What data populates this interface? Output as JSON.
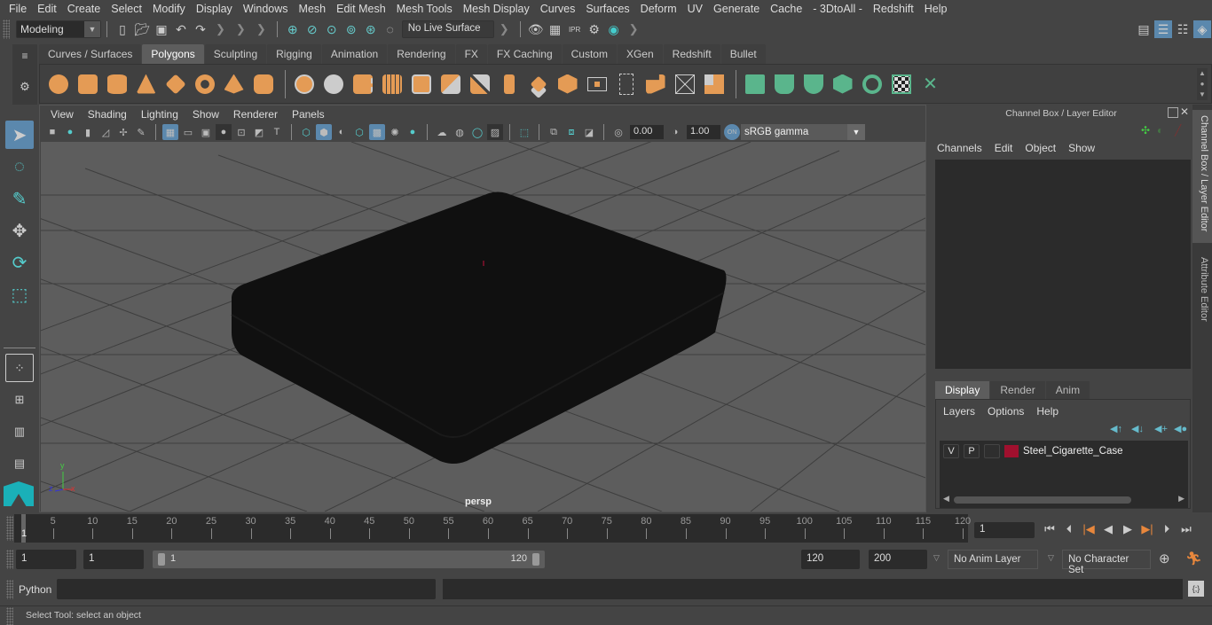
{
  "menubar": [
    "File",
    "Edit",
    "Create",
    "Select",
    "Modify",
    "Display",
    "Windows",
    "Mesh",
    "Edit Mesh",
    "Mesh Tools",
    "Mesh Display",
    "Curves",
    "Surfaces",
    "Deform",
    "UV",
    "Generate",
    "Cache",
    "- 3DtoAll -",
    "Redshift",
    "Help"
  ],
  "statusline": {
    "mode": "Modeling",
    "live_surface": "No Live Surface"
  },
  "shelf": {
    "tabs": [
      "Curves / Surfaces",
      "Polygons",
      "Sculpting",
      "Rigging",
      "Animation",
      "Rendering",
      "FX",
      "FX Caching",
      "Custom",
      "XGen",
      "Redshift",
      "Bullet"
    ],
    "active_tab": "Polygons",
    "orange_icons": [
      "poly-sphere-icon",
      "poly-cube-icon",
      "poly-cylinder-icon",
      "poly-cone-icon",
      "poly-plane-icon",
      "poly-torus-icon",
      "poly-pyramid-icon",
      "poly-pipe-icon",
      "combine-icon",
      "separate-icon",
      "mirror-icon",
      "smooth-icon",
      "boolean-icon",
      "extrude-icon",
      "bridge-icon",
      "multi-cut-icon",
      "bevel-icon",
      "merge-icon",
      "fill-hole-icon",
      "center-pivot-icon",
      "target-weld-icon",
      "poke-icon",
      "wedge-icon"
    ],
    "green_icons": [
      "planar-uv-icon",
      "cylindrical-uv-icon",
      "spherical-uv-icon",
      "automatic-uv-icon",
      "unfold-uv-icon",
      "uv-editor-icon",
      "layout-uv-icon"
    ]
  },
  "viewport": {
    "menu": [
      "View",
      "Shading",
      "Lighting",
      "Show",
      "Renderer",
      "Panels"
    ],
    "exposure": "0.00",
    "gamma_value": "1.00",
    "color_space": "sRGB gamma",
    "camera_label": "persp",
    "axis": {
      "x": "x",
      "y": "y",
      "z": "z"
    }
  },
  "channel_box": {
    "title": "Channel Box / Layer Editor",
    "menu": [
      "Channels",
      "Edit",
      "Object",
      "Show"
    ]
  },
  "layer_editor": {
    "tabs": [
      "Display",
      "Render",
      "Anim"
    ],
    "active_tab": "Display",
    "menu": [
      "Layers",
      "Options",
      "Help"
    ],
    "layers": [
      {
        "visible": "V",
        "playback": "P",
        "name": "Steel_Cigarette_Case",
        "color": "#a0102e"
      }
    ]
  },
  "side_tabs": [
    "Channel Box / Layer Editor",
    "Attribute Editor"
  ],
  "timeline": {
    "ticks": [
      5,
      10,
      15,
      20,
      25,
      30,
      35,
      40,
      45,
      50,
      55,
      60,
      65,
      70,
      75,
      80,
      85,
      90,
      95,
      100,
      105,
      110,
      115,
      120
    ],
    "current_frame_label": "1",
    "current_frame": "1"
  },
  "range": {
    "start_time": "1",
    "playback_start": "1",
    "slider_start": "1",
    "slider_end": "120",
    "playback_end": "120",
    "end_time": "200",
    "anim_layer": "No Anim Layer",
    "character_set": "No Character Set"
  },
  "command_line": {
    "label": "Python",
    "value": ""
  },
  "status_bar": {
    "message": "Select Tool: select an object"
  }
}
